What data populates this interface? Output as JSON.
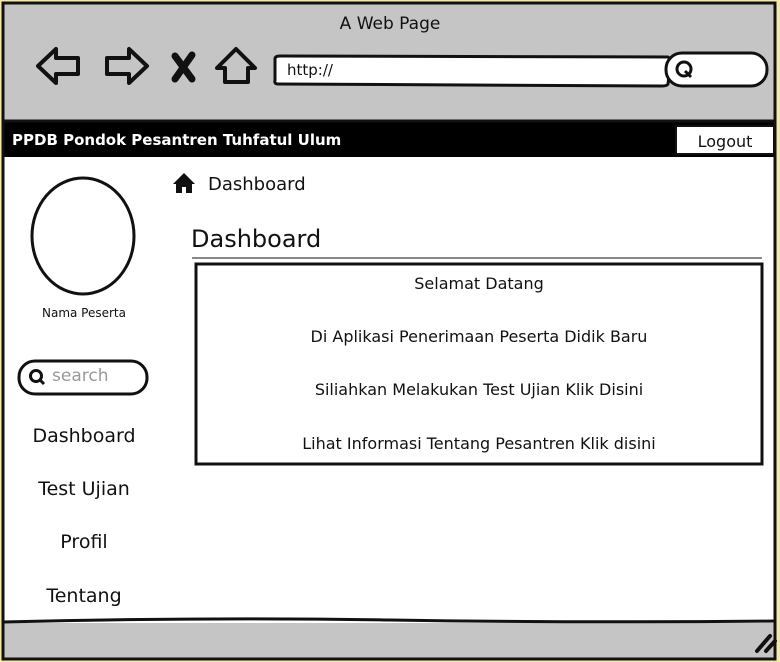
{
  "browser": {
    "title": "A Web Page",
    "url_value": "http://",
    "icons": [
      "back-arrow-icon",
      "forward-arrow-icon",
      "close-x-icon",
      "home-icon",
      "search-icon"
    ]
  },
  "app": {
    "brand": "PPDB Pondok Pesantren Tuhfatul Ulum",
    "logout_label": "Logout"
  },
  "sidebar": {
    "user_name": "Nama Peserta",
    "search_placeholder": "search",
    "items": [
      {
        "label": "Dashboard"
      },
      {
        "label": "Test Ujian"
      },
      {
        "label": "Profil"
      },
      {
        "label": "Tentang"
      }
    ]
  },
  "main": {
    "breadcrumb": "Dashboard",
    "page_title": "Dashboard",
    "welcome_lines": [
      "Selamat Datang",
      "Di Aplikasi Penerimaan Peserta Didik Baru",
      "Siliahkan Melakukan Test Ujian Klik Disini",
      "Lihat Informasi Tentang Pesantren Klik disini"
    ]
  },
  "colors": {
    "chrome": "#c5c5c5",
    "navbar": "#000000",
    "page_bg": "#ffffff",
    "ink": "#111111",
    "outer_bg": "#f4e9a6"
  }
}
